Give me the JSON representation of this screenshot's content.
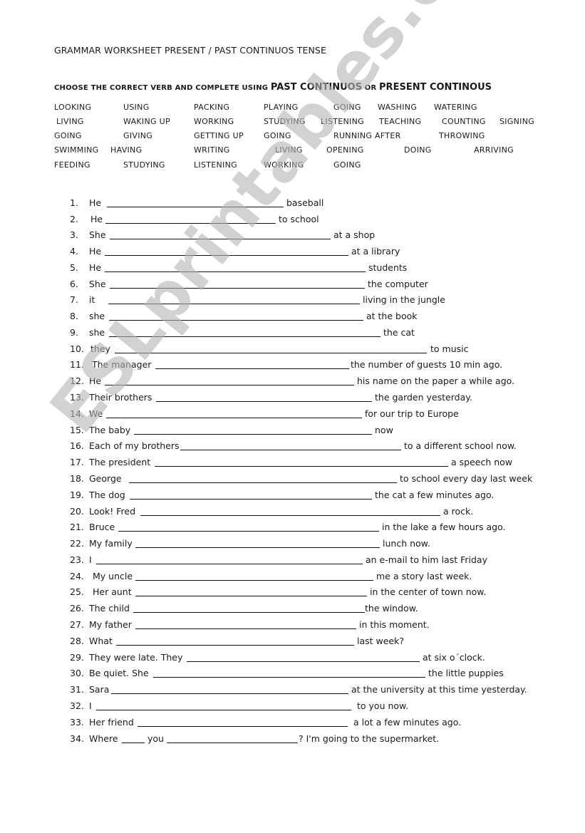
{
  "title": "GRAMMAR WORKSHEET PRESENT / PAST  CONTINUOS TENSE",
  "instructions": {
    "part1": "CHOOSE THE CORRECT VERB AND COMPLETE USING ",
    "part2": "PAST CONTINUOS",
    "part3": " OR ",
    "part4": "PRESENT CONTINOUS"
  },
  "verb_bank": [
    [
      "LOOKING",
      "USING",
      "PACKING",
      "PLAYING",
      "GOING",
      "WASHING",
      "WATERING"
    ],
    [
      "LIVING",
      "WAKING UP",
      "WORKING",
      "STUDYING",
      "LISTENING",
      "TEACHING",
      "COUNTING",
      "SIGNING"
    ],
    [
      "GOING",
      "GIVING",
      "GETTING UP",
      "GOING",
      "RUNNING AFTER",
      "THROWING"
    ],
    [
      "SWIMMING",
      "HAVING",
      "WRITING",
      "LIVING",
      "OPENING",
      "DOING",
      "ARRIVING"
    ],
    [
      "FEEDING",
      "STUDYING",
      "LISTENING",
      "WORKING",
      "GOING"
    ]
  ],
  "exercises": [
    {
      "num": "1.",
      "subject": "He",
      "ending": "baseball"
    },
    {
      "num": "2.",
      "subject": "He",
      "ending": "to school"
    },
    {
      "num": "3.",
      "subject": "She",
      "ending": "at a shop"
    },
    {
      "num": "4.",
      "subject": "He",
      "ending": "at a library"
    },
    {
      "num": "5.",
      "subject": "He",
      "ending": "students"
    },
    {
      "num": "6.",
      "subject": "She",
      "ending": "the computer"
    },
    {
      "num": "7.",
      "subject": "it",
      "ending": "living in the jungle"
    },
    {
      "num": "8.",
      "subject": "she",
      "ending": "at the book"
    },
    {
      "num": "9.",
      "subject": "she",
      "ending": "the cat"
    },
    {
      "num": "10.",
      "subject": "they",
      "ending": "to music"
    },
    {
      "num": "11.",
      "subject": "The manager",
      "ending": "the number of guests 10 min ago."
    },
    {
      "num": "12.",
      "subject": "He",
      "ending": "his name on the paper a while ago."
    },
    {
      "num": "13.",
      "subject": "Their brothers",
      "ending": "the garden  yesterday."
    },
    {
      "num": "14.",
      "subject": "We",
      "ending": "for our trip to Europe"
    },
    {
      "num": "15.",
      "subject": "The baby",
      "ending": "now"
    },
    {
      "num": "16.",
      "subject": "Each of my brothers",
      "ending": "to a different school now."
    },
    {
      "num": "17.",
      "subject": "The president",
      "ending": "a speech now"
    },
    {
      "num": "18.",
      "subject": "George",
      "ending": "to school every day last week"
    },
    {
      "num": "19.",
      "subject": "The dog",
      "ending": "the cat a few minutes ago."
    },
    {
      "num": "20.",
      "subject": "Look! Fred",
      "ending": "a rock."
    },
    {
      "num": "21.",
      "subject": "Bruce",
      "ending": "in the lake a few hours ago."
    },
    {
      "num": "22.",
      "subject": "My family",
      "ending": "lunch now."
    },
    {
      "num": "23.",
      "subject": "I",
      "ending": "an e-mail to him last Friday"
    },
    {
      "num": "24.",
      "subject": "My uncle",
      "ending": "me a story last week."
    },
    {
      "num": "25.",
      "subject": "Her aunt",
      "ending": "in the center of town now."
    },
    {
      "num": "26.",
      "subject": "The child",
      "ending": "the window."
    },
    {
      "num": "27.",
      "subject": "My father",
      "ending": "in this moment."
    },
    {
      "num": "28.",
      "subject": "What",
      "ending": "last week?"
    },
    {
      "num": "29.",
      "subject": "They were late. They",
      "ending": "at six o´clock."
    },
    {
      "num": "30.",
      "subject": "Be quiet. She",
      "ending": "the little puppies"
    },
    {
      "num": "31.",
      "subject": "Sara",
      "ending": "at the university at this time yesterday."
    },
    {
      "num": "32.",
      "subject": "I",
      "ending": "to you now."
    },
    {
      "num": "33.",
      "subject": "Her friend",
      "ending": "a lot a few minutes ago."
    },
    {
      "num": "34.",
      "subject": "Where",
      "middle": "you",
      "ending": "? I'm going to the supermarket."
    }
  ],
  "watermark": "ESLprintables.com"
}
